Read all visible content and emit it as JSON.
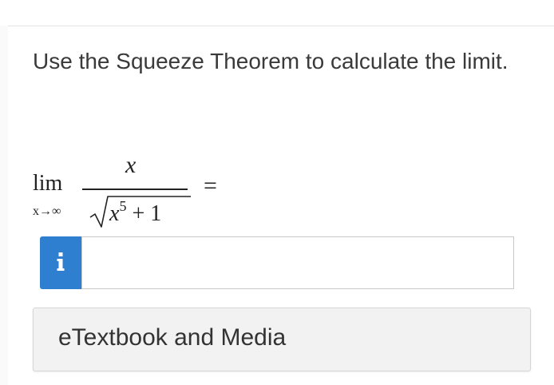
{
  "question": {
    "text": "Use the Squeeze Theorem to calculate the limit."
  },
  "expression": {
    "lim_word": "lim",
    "lim_subscript": "x→∞",
    "numerator": "x",
    "denominator_var": "x",
    "denominator_exponent": "5",
    "denominator_rest": " + 1",
    "equals": "="
  },
  "answer": {
    "value": "",
    "placeholder": ""
  },
  "info_button": {
    "icon": "info-icon",
    "glyph": "i"
  },
  "media_button": {
    "label": "eTextbook and Media"
  },
  "colors": {
    "accent": "#2f7fd1",
    "text": "#333333",
    "button_bg": "#f2f2f2"
  }
}
